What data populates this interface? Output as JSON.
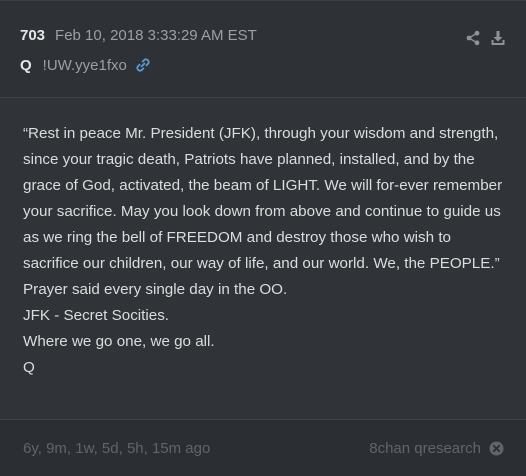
{
  "post": {
    "number": "703",
    "date": "Feb 10, 2018 3:33:29 AM EST",
    "author": "Q",
    "tripcode": "!UW.yye1fxo",
    "link_icon": "link-icon"
  },
  "actions": {
    "share_icon": "share-icon",
    "download_icon": "download-icon"
  },
  "body": {
    "quote": "“Rest in peace Mr. President (JFK), through your wisdom and strength, since your tragic death, Patriots have planned, installed, and by the grace of God, activated, the beam of LIGHT. We will for-ever remember your sacrifice. May you look down from above and continue to guide us as we ring the bell of FREEDOM and destroy those who wish to sacrifice our children, our way of life, and our world. We, the PEOPLE.”",
    "lines": [
      "Prayer said every single day in the OO.",
      "JFK - Secret Socities.",
      "Where we go one, we go all.",
      "Q"
    ]
  },
  "footer": {
    "ago": "6y, 9m, 1w, 5d, 5h, 15m ago",
    "source": "8chan qresearch",
    "close_icon": "close-circle-icon"
  },
  "colors": {
    "background": "#2e3236",
    "text": "#dcdcdc",
    "muted": "#9aa0a6",
    "link": "#5b9bd5"
  }
}
